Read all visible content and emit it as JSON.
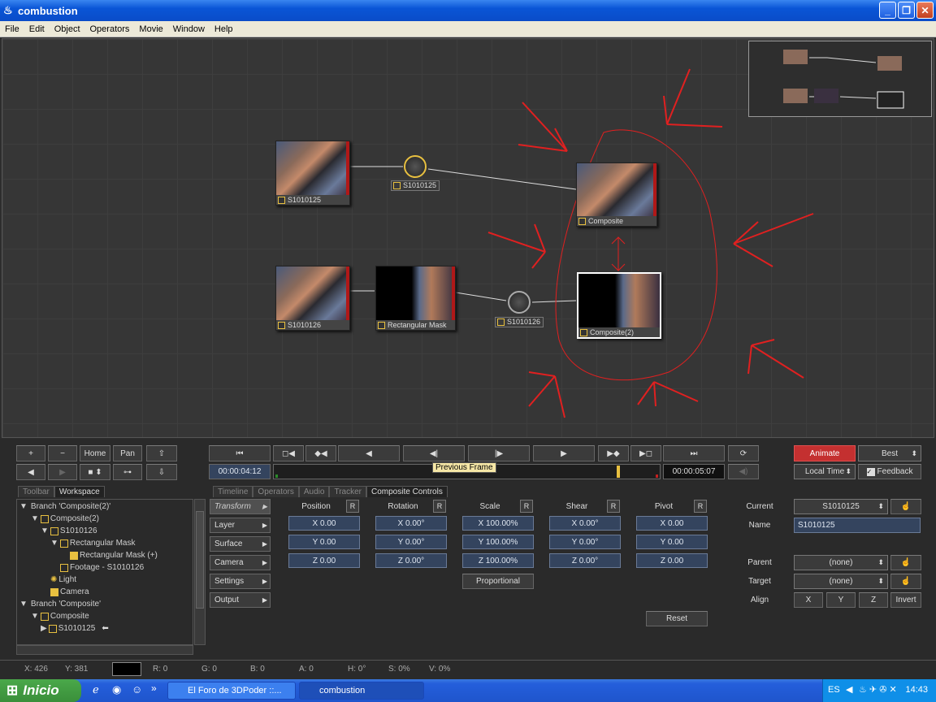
{
  "window": {
    "title": "combustion"
  },
  "menu": [
    "File",
    "Edit",
    "Object",
    "Operators",
    "Movie",
    "Window",
    "Help"
  ],
  "schematic": {
    "nodes": [
      {
        "label": "S1010125"
      },
      {
        "label": "S1010125"
      },
      {
        "label": "Composite"
      },
      {
        "label": "S1010126"
      },
      {
        "label": "Rectangular Mask"
      },
      {
        "label": "S1010126"
      },
      {
        "label": "Composite(2)"
      }
    ]
  },
  "toolbar": {
    "plus": "+",
    "minus": "−",
    "home": "Home",
    "pan": "Pan"
  },
  "transport": {
    "current_time": "00:00:04:12",
    "end_time": "00:00:05:07",
    "tooltip": "Previous Frame",
    "animate": "Animate",
    "quality": "Best",
    "time_mode": "Local Time",
    "feedback": "Feedback"
  },
  "left_tabs": [
    "Toolbar",
    "Workspace"
  ],
  "tree": [
    {
      "label": "Branch 'Composite(2)'"
    },
    {
      "label": "Composite(2)"
    },
    {
      "label": "S1010126"
    },
    {
      "label": "Rectangular Mask"
    },
    {
      "label": "Rectangular Mask (+)"
    },
    {
      "label": "Footage - S1010126"
    },
    {
      "label": "Light"
    },
    {
      "label": "Camera"
    },
    {
      "label": "Branch 'Composite'"
    },
    {
      "label": "Composite"
    },
    {
      "label": "S1010125"
    }
  ],
  "control_tabs": [
    "Timeline",
    "Operators",
    "Audio",
    "Tracker",
    "Composite Controls"
  ],
  "categories": [
    "Transform",
    "Layer",
    "Surface",
    "Camera",
    "Settings",
    "Output"
  ],
  "columns": [
    {
      "title": "Position",
      "r": "R",
      "x": "X 0.00",
      "y": "Y 0.00",
      "z": "Z 0.00"
    },
    {
      "title": "Rotation",
      "r": "R",
      "x": "X 0.00°",
      "y": "Y 0.00°",
      "z": "Z 0.00°"
    },
    {
      "title": "Scale",
      "r": "R",
      "x": "X 100.00%",
      "y": "Y 100.00%",
      "z": "Z 100.00%"
    },
    {
      "title": "Shear",
      "r": "R",
      "x": "X 0.00°",
      "y": "Y 0.00°",
      "z": "Z 0.00°"
    },
    {
      "title": "Pivot",
      "r": "R",
      "x": "X 0.00",
      "y": "Y 0.00",
      "z": "Z 0.00"
    }
  ],
  "proportional": "Proportional",
  "reset": "Reset",
  "props": {
    "current_label": "Current",
    "current_value": "S1010125",
    "name_label": "Name",
    "name_value": "S1010125",
    "parent_label": "Parent",
    "parent_value": "(none)",
    "target_label": "Target",
    "target_value": "(none)",
    "align_label": "Align",
    "align_x": "X",
    "align_y": "Y",
    "align_z": "Z",
    "invert": "Invert"
  },
  "status": {
    "x": "X:  426",
    "y": "Y:  381",
    "r": "R: 0",
    "g": "G: 0",
    "b": "B: 0",
    "a": "A: 0",
    "h": "H: 0°",
    "s": "S: 0%",
    "v": "V: 0%"
  },
  "taskbar": {
    "start": "Inicio",
    "tasks": [
      "El Foro de 3DPoder ::...",
      "combustion"
    ],
    "lang": "ES",
    "clock": "14:43"
  }
}
